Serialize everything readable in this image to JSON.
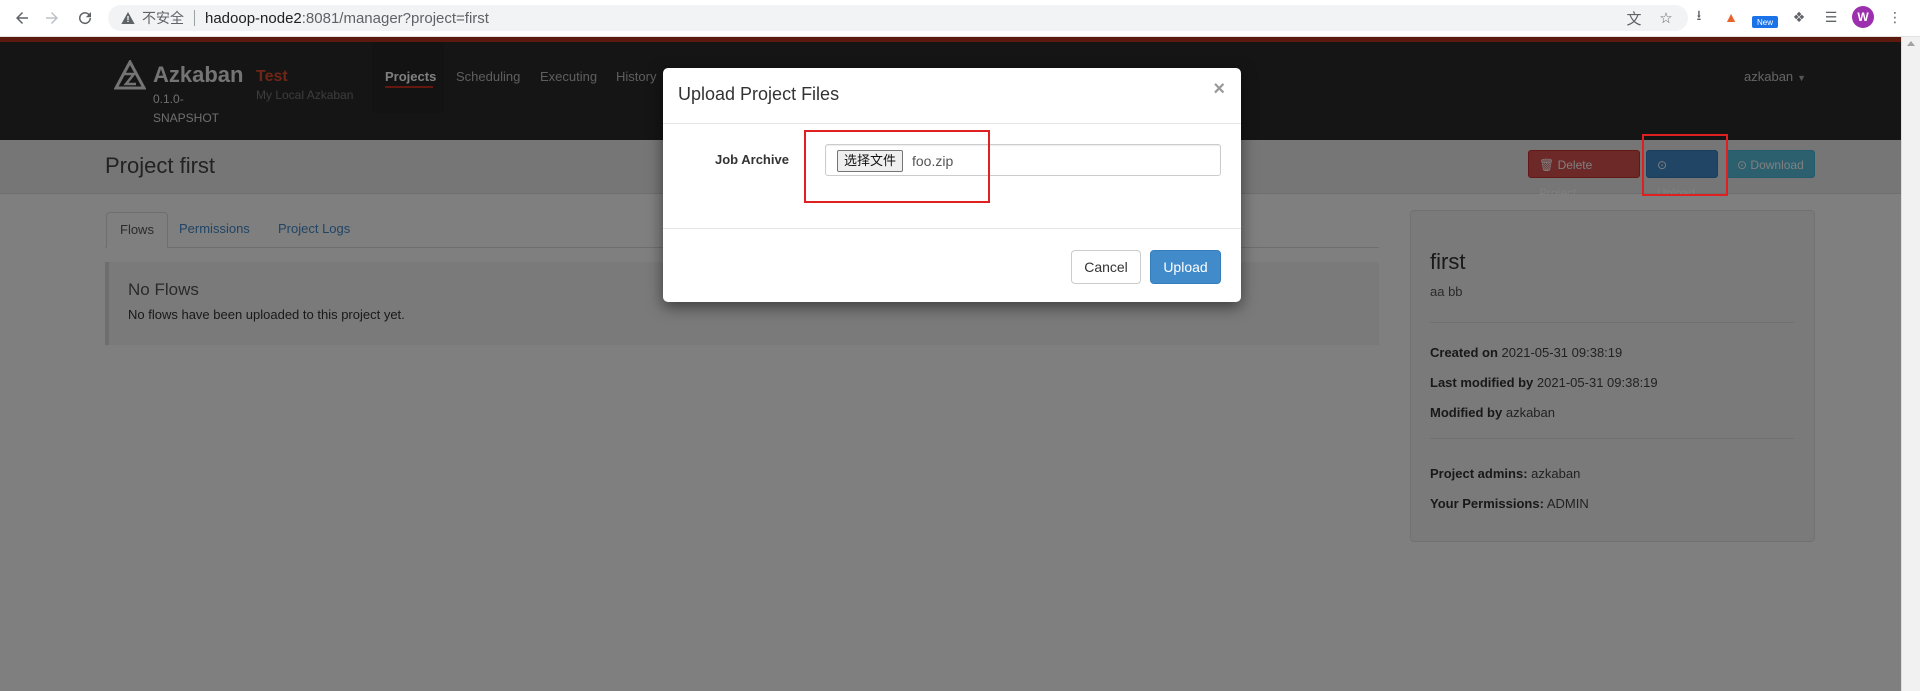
{
  "browser": {
    "insecure_label": "不安全",
    "url_host": "hadoop-node2",
    "url_rest": ":8081/manager?project=first",
    "new_badge": "New",
    "profile_initial": "W"
  },
  "navbar": {
    "brand": "Azkaban",
    "version": "0.1.0-SNAPSHOT",
    "env_name": "Test",
    "env_desc": "My Local Azkaban",
    "tabs": [
      "Projects",
      "Scheduling",
      "Executing",
      "History"
    ],
    "user": "azkaban"
  },
  "project": {
    "title": "Project first",
    "delete_label": "Delete Project",
    "upload_label": "Upload",
    "download_label": "Download"
  },
  "tabs": [
    "Flows",
    "Permissions",
    "Project Logs"
  ],
  "flows": {
    "title": "No Flows",
    "text": "No flows have been uploaded to this project yet."
  },
  "info": {
    "name": "first",
    "description": "aa bb",
    "created_label": "Created on",
    "created_value": "2021-05-31 09:38:19",
    "modified_label": "Last modified by",
    "modified_value": "2021-05-31 09:38:19",
    "modified_by_label": "Modified by",
    "modified_by_value": "azkaban",
    "admins_label": "Project admins:",
    "admins_value": "azkaban",
    "permissions_label": "Your Permissions:",
    "permissions_value": "ADMIN"
  },
  "modal": {
    "title": "Upload Project Files",
    "close": "×",
    "job_archive_label": "Job Archive",
    "choose_file_label": "选择文件",
    "file_name": "foo.zip",
    "cancel_label": "Cancel",
    "upload_label": "Upload"
  },
  "colors": {
    "accent_red": "#b9341d",
    "primary": "#428bca",
    "danger": "#d9534f",
    "info": "#5bc0de",
    "highlight_box": "#e02020"
  }
}
